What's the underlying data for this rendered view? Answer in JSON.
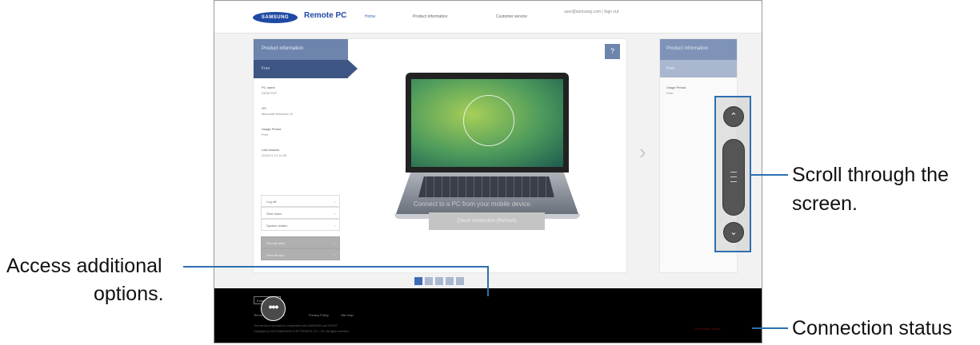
{
  "header": {
    "logo_text": "SAMSUNG",
    "app_title": "Remote PC",
    "nav": [
      "Home",
      "Product information",
      "Customer service"
    ],
    "account": "user@samsung.com | Sign out"
  },
  "product_panel": {
    "title": "Product information",
    "tab": "Free",
    "fields": [
      {
        "label": "PC name",
        "value": "DESKTOP"
      },
      {
        "label": "OS",
        "value": "Microsoft Windows 10"
      },
      {
        "label": "Usage Period",
        "value": "Free"
      },
      {
        "label": "Last session",
        "value": "2016.01.12 14:30"
      }
    ],
    "menu_items": [
      "Log off",
      "Shut down",
      "System restart"
    ],
    "dark_items": [
      "Remote start",
      "Remote stop"
    ],
    "help_icon": "question-icon"
  },
  "connect": {
    "message": "Connect to a PC from your mobile device.",
    "check_button": "Check connection (Refresh)"
  },
  "right_panel": {
    "title": "Product information",
    "tab": "Free",
    "field": "Usage Period",
    "value": "Free"
  },
  "pagination": {
    "count": 5,
    "active": 1
  },
  "footer": {
    "language": "English",
    "links": [
      "Terms and Conditions",
      "Privacy Policy",
      "Site map"
    ],
    "copyright_1": "This service is provided in cooperation with SAMSUNG and KSOFT.",
    "copyright_2": "Copyright (c) 2016 SAMSUNG ELECTRONICS CO., LTD. All rights reserved.",
    "connection_status": "Connection status"
  },
  "more_button": {
    "icon": "more-icon",
    "glyph": "•••"
  },
  "scroll_widget": {
    "up_glyph": "⌃",
    "down_glyph": "⌄"
  },
  "callouts": {
    "scroll_line1": "Scroll through the",
    "scroll_line2": "screen.",
    "options_line1": "Access additional",
    "options_line2": "options.",
    "status": "Connection status"
  },
  "colors": {
    "accent": "#2d6fb0",
    "panel": "#6d85ad",
    "panel_dark": "#3e5684"
  }
}
